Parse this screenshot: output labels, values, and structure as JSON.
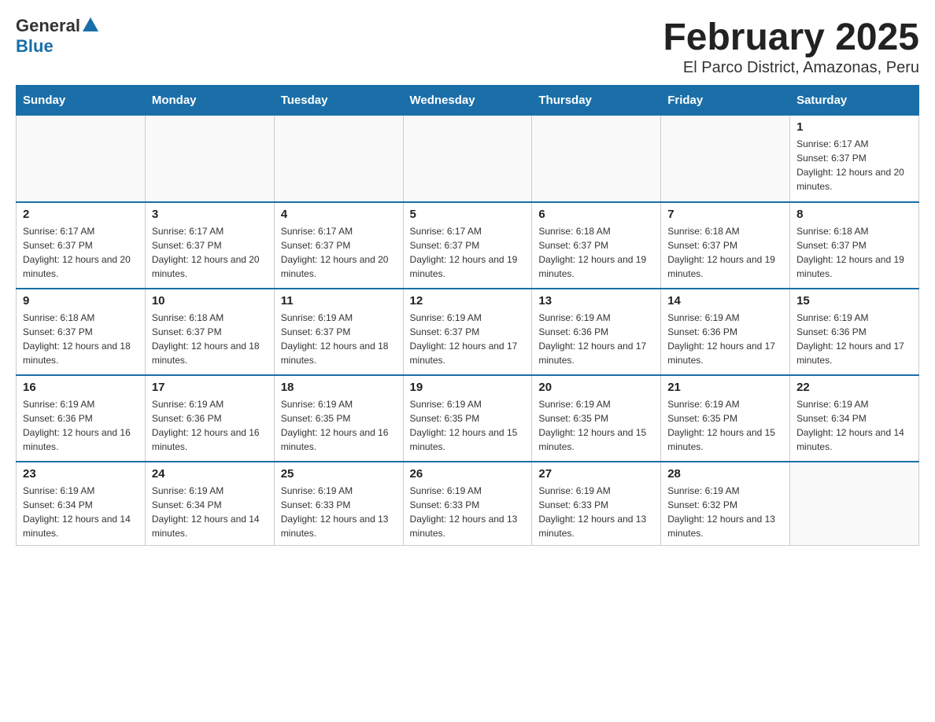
{
  "header": {
    "logo_general": "General",
    "logo_blue": "Blue",
    "title": "February 2025",
    "subtitle": "El Parco District, Amazonas, Peru"
  },
  "weekdays": [
    "Sunday",
    "Monday",
    "Tuesday",
    "Wednesday",
    "Thursday",
    "Friday",
    "Saturday"
  ],
  "weeks": [
    [
      {
        "day": "",
        "sunrise": "",
        "sunset": "",
        "daylight": ""
      },
      {
        "day": "",
        "sunrise": "",
        "sunset": "",
        "daylight": ""
      },
      {
        "day": "",
        "sunrise": "",
        "sunset": "",
        "daylight": ""
      },
      {
        "day": "",
        "sunrise": "",
        "sunset": "",
        "daylight": ""
      },
      {
        "day": "",
        "sunrise": "",
        "sunset": "",
        "daylight": ""
      },
      {
        "day": "",
        "sunrise": "",
        "sunset": "",
        "daylight": ""
      },
      {
        "day": "1",
        "sunrise": "Sunrise: 6:17 AM",
        "sunset": "Sunset: 6:37 PM",
        "daylight": "Daylight: 12 hours and 20 minutes."
      }
    ],
    [
      {
        "day": "2",
        "sunrise": "Sunrise: 6:17 AM",
        "sunset": "Sunset: 6:37 PM",
        "daylight": "Daylight: 12 hours and 20 minutes."
      },
      {
        "day": "3",
        "sunrise": "Sunrise: 6:17 AM",
        "sunset": "Sunset: 6:37 PM",
        "daylight": "Daylight: 12 hours and 20 minutes."
      },
      {
        "day": "4",
        "sunrise": "Sunrise: 6:17 AM",
        "sunset": "Sunset: 6:37 PM",
        "daylight": "Daylight: 12 hours and 20 minutes."
      },
      {
        "day": "5",
        "sunrise": "Sunrise: 6:17 AM",
        "sunset": "Sunset: 6:37 PM",
        "daylight": "Daylight: 12 hours and 19 minutes."
      },
      {
        "day": "6",
        "sunrise": "Sunrise: 6:18 AM",
        "sunset": "Sunset: 6:37 PM",
        "daylight": "Daylight: 12 hours and 19 minutes."
      },
      {
        "day": "7",
        "sunrise": "Sunrise: 6:18 AM",
        "sunset": "Sunset: 6:37 PM",
        "daylight": "Daylight: 12 hours and 19 minutes."
      },
      {
        "day": "8",
        "sunrise": "Sunrise: 6:18 AM",
        "sunset": "Sunset: 6:37 PM",
        "daylight": "Daylight: 12 hours and 19 minutes."
      }
    ],
    [
      {
        "day": "9",
        "sunrise": "Sunrise: 6:18 AM",
        "sunset": "Sunset: 6:37 PM",
        "daylight": "Daylight: 12 hours and 18 minutes."
      },
      {
        "day": "10",
        "sunrise": "Sunrise: 6:18 AM",
        "sunset": "Sunset: 6:37 PM",
        "daylight": "Daylight: 12 hours and 18 minutes."
      },
      {
        "day": "11",
        "sunrise": "Sunrise: 6:19 AM",
        "sunset": "Sunset: 6:37 PM",
        "daylight": "Daylight: 12 hours and 18 minutes."
      },
      {
        "day": "12",
        "sunrise": "Sunrise: 6:19 AM",
        "sunset": "Sunset: 6:37 PM",
        "daylight": "Daylight: 12 hours and 17 minutes."
      },
      {
        "day": "13",
        "sunrise": "Sunrise: 6:19 AM",
        "sunset": "Sunset: 6:36 PM",
        "daylight": "Daylight: 12 hours and 17 minutes."
      },
      {
        "day": "14",
        "sunrise": "Sunrise: 6:19 AM",
        "sunset": "Sunset: 6:36 PM",
        "daylight": "Daylight: 12 hours and 17 minutes."
      },
      {
        "day": "15",
        "sunrise": "Sunrise: 6:19 AM",
        "sunset": "Sunset: 6:36 PM",
        "daylight": "Daylight: 12 hours and 17 minutes."
      }
    ],
    [
      {
        "day": "16",
        "sunrise": "Sunrise: 6:19 AM",
        "sunset": "Sunset: 6:36 PM",
        "daylight": "Daylight: 12 hours and 16 minutes."
      },
      {
        "day": "17",
        "sunrise": "Sunrise: 6:19 AM",
        "sunset": "Sunset: 6:36 PM",
        "daylight": "Daylight: 12 hours and 16 minutes."
      },
      {
        "day": "18",
        "sunrise": "Sunrise: 6:19 AM",
        "sunset": "Sunset: 6:35 PM",
        "daylight": "Daylight: 12 hours and 16 minutes."
      },
      {
        "day": "19",
        "sunrise": "Sunrise: 6:19 AM",
        "sunset": "Sunset: 6:35 PM",
        "daylight": "Daylight: 12 hours and 15 minutes."
      },
      {
        "day": "20",
        "sunrise": "Sunrise: 6:19 AM",
        "sunset": "Sunset: 6:35 PM",
        "daylight": "Daylight: 12 hours and 15 minutes."
      },
      {
        "day": "21",
        "sunrise": "Sunrise: 6:19 AM",
        "sunset": "Sunset: 6:35 PM",
        "daylight": "Daylight: 12 hours and 15 minutes."
      },
      {
        "day": "22",
        "sunrise": "Sunrise: 6:19 AM",
        "sunset": "Sunset: 6:34 PM",
        "daylight": "Daylight: 12 hours and 14 minutes."
      }
    ],
    [
      {
        "day": "23",
        "sunrise": "Sunrise: 6:19 AM",
        "sunset": "Sunset: 6:34 PM",
        "daylight": "Daylight: 12 hours and 14 minutes."
      },
      {
        "day": "24",
        "sunrise": "Sunrise: 6:19 AM",
        "sunset": "Sunset: 6:34 PM",
        "daylight": "Daylight: 12 hours and 14 minutes."
      },
      {
        "day": "25",
        "sunrise": "Sunrise: 6:19 AM",
        "sunset": "Sunset: 6:33 PM",
        "daylight": "Daylight: 12 hours and 13 minutes."
      },
      {
        "day": "26",
        "sunrise": "Sunrise: 6:19 AM",
        "sunset": "Sunset: 6:33 PM",
        "daylight": "Daylight: 12 hours and 13 minutes."
      },
      {
        "day": "27",
        "sunrise": "Sunrise: 6:19 AM",
        "sunset": "Sunset: 6:33 PM",
        "daylight": "Daylight: 12 hours and 13 minutes."
      },
      {
        "day": "28",
        "sunrise": "Sunrise: 6:19 AM",
        "sunset": "Sunset: 6:32 PM",
        "daylight": "Daylight: 12 hours and 13 minutes."
      },
      {
        "day": "",
        "sunrise": "",
        "sunset": "",
        "daylight": ""
      }
    ]
  ]
}
